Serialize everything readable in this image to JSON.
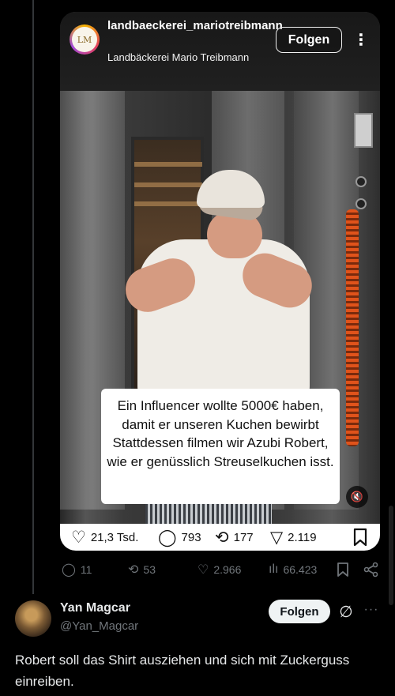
{
  "embed": {
    "account_handle": "landbaeckerei_mariotreibmann",
    "account_name": "Landbäckerei Mario Treibmann",
    "follow_label": "Folgen",
    "more_label": "⋮",
    "avatar_label": "LM",
    "caption": "Ein Influencer wollte 5000€ haben, damit er unseren Kuchen bewirbt Stattdessen filmen wir Azubi Robert, wie er genüsslich Streuselkuchen isst.",
    "mute_icon": "🔇",
    "stats": {
      "likes": "21,3 Tsd.",
      "comments": "793",
      "reposts": "177",
      "shares": "2.119"
    }
  },
  "tweet_actions": {
    "replies": "11",
    "retweets": "53",
    "likes": "2.966",
    "views": "66.423"
  },
  "reply": {
    "name": "Yan Magcar",
    "handle": "@Yan_Magcar",
    "follow_label": "Folgen",
    "more_label": "···",
    "text": "Robert soll das Shirt ausziehen und sich mit Zuckerguss einreiben."
  },
  "icons": {
    "heart": "♡",
    "comment": "◯",
    "repost": "⟲",
    "share": "▽",
    "views": "ılı",
    "grok": "∅"
  }
}
